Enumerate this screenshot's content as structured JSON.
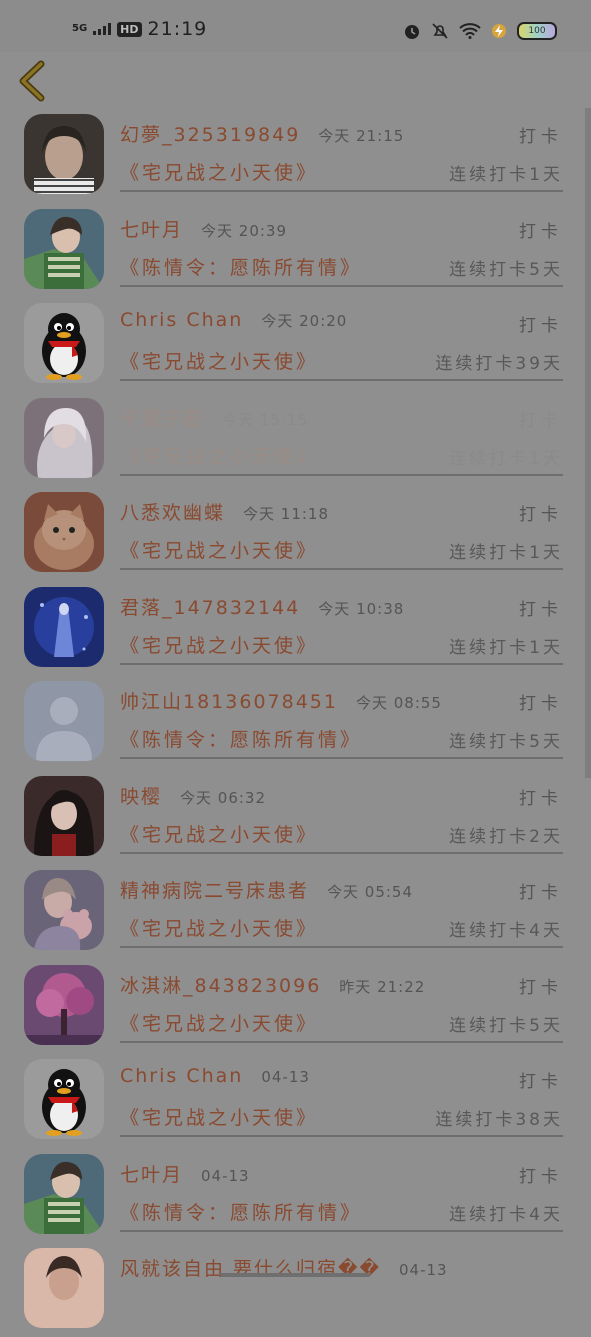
{
  "status_bar": {
    "network": "5G",
    "hd": "HD",
    "time": "21:19",
    "battery": "100"
  },
  "items": [
    {
      "name": "幻夢_325319849",
      "time": "今天 21:15",
      "action": "打卡",
      "book": "《宅兄战之小天使》",
      "streak": "连续打卡1天",
      "avatar": "girl-photo"
    },
    {
      "name": "七叶月",
      "time": "今天 20:39",
      "action": "打卡",
      "book": "《陈情令：愿陈所有情》",
      "streak": "连续打卡5天",
      "avatar": "anime-boy"
    },
    {
      "name": "Chris Chan",
      "time": "今天 20:20",
      "action": "打卡",
      "book": "《宅兄战之小天使》",
      "streak": "连续打卡39天",
      "avatar": "qq-penguin"
    },
    {
      "name": "子萤子若",
      "time": "今天 15:15",
      "action": "打卡",
      "book": "《宅兄战之小天使》",
      "streak": "连续打卡1天",
      "avatar": "anime-white-hair"
    },
    {
      "name": "八悉欢幽蝶",
      "time": "今天 11:18",
      "action": "打卡",
      "book": "《宅兄战之小天使》",
      "streak": "连续打卡1天",
      "avatar": "kitten"
    },
    {
      "name": "君落_147832144",
      "time": "今天 10:38",
      "action": "打卡",
      "book": "《宅兄战之小天使》",
      "streak": "连续打卡1天",
      "avatar": "blue-fantasy"
    },
    {
      "name": "帅江山18136078451",
      "time": "今天 08:55",
      "action": "打卡",
      "book": "《陈情令：愿陈所有情》",
      "streak": "连续打卡5天",
      "avatar": "default-person"
    },
    {
      "name": "映樱",
      "time": "今天 06:32",
      "action": "打卡",
      "book": "《宅兄战之小天使》",
      "streak": "连续打卡2天",
      "avatar": "anime-dark-hair"
    },
    {
      "name": "精神病院二号床患者",
      "time": "今天 05:54",
      "action": "打卡",
      "book": "《宅兄战之小天使》",
      "streak": "连续打卡4天",
      "avatar": "girl-with-toy"
    },
    {
      "name": "冰淇淋_843823096",
      "time": "昨天 21:22",
      "action": "打卡",
      "book": "《宅兄战之小天使》",
      "streak": "连续打卡5天",
      "avatar": "pink-tree"
    },
    {
      "name": "Chris Chan",
      "time": "04-13",
      "action": "打卡",
      "book": "《宅兄战之小天使》",
      "streak": "连续打卡38天",
      "avatar": "qq-penguin"
    },
    {
      "name": "七叶月",
      "time": "04-13",
      "action": "打卡",
      "book": "《陈情令：愿陈所有情》",
      "streak": "连续打卡4天",
      "avatar": "anime-boy"
    },
    {
      "name": "风就该自由 要什么归宿��",
      "time": "04-13",
      "action": "",
      "book": "",
      "streak": "",
      "avatar": "girl-photo-2"
    }
  ]
}
